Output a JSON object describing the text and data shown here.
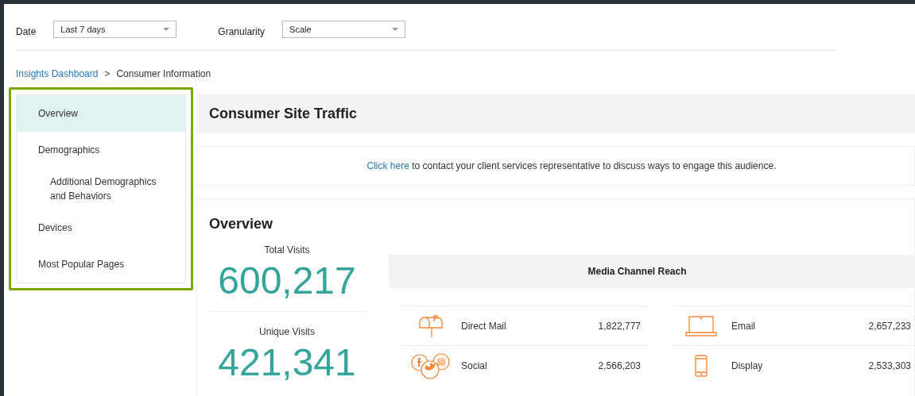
{
  "filters": [
    {
      "label": "Date",
      "value": "Last 7 days"
    },
    {
      "label": "Granularity",
      "value": "Scale"
    }
  ],
  "breadcrumb": {
    "link": "Insights Dashboard",
    "separator": ">",
    "current": "Consumer Information"
  },
  "sidebar": {
    "highlighted": true,
    "items": [
      {
        "label": "Overview",
        "selected": true
      },
      {
        "label": "Demographics",
        "selected": false,
        "children": [
          {
            "label": "Additional Demographics and Behaviors",
            "selected": false
          }
        ]
      },
      {
        "label": "Devices",
        "selected": false
      },
      {
        "label": "Most Popular Pages",
        "selected": false
      }
    ]
  },
  "page_title": "Consumer Site Traffic",
  "notice": {
    "link": "Click here",
    "text": "to contact your client services representative to discuss ways to engage this audience."
  },
  "overview": {
    "title": "Overview",
    "stats": [
      {
        "label": "Total Visits",
        "value": "600,217"
      },
      {
        "label": "Unique Visits",
        "value": "421,341"
      }
    ],
    "media_channel_reach": {
      "title": "Media Channel Reach",
      "channels": [
        {
          "kind": "mailbox",
          "name": "Direct Mail",
          "value": "1,822,777"
        },
        {
          "kind": "laptop",
          "name": "Email",
          "value": "2,657,233"
        },
        {
          "kind": "social",
          "name": "Social",
          "value": "2,566,203"
        },
        {
          "kind": "phone",
          "name": "Display",
          "value": "2,533,303"
        }
      ]
    }
  }
}
